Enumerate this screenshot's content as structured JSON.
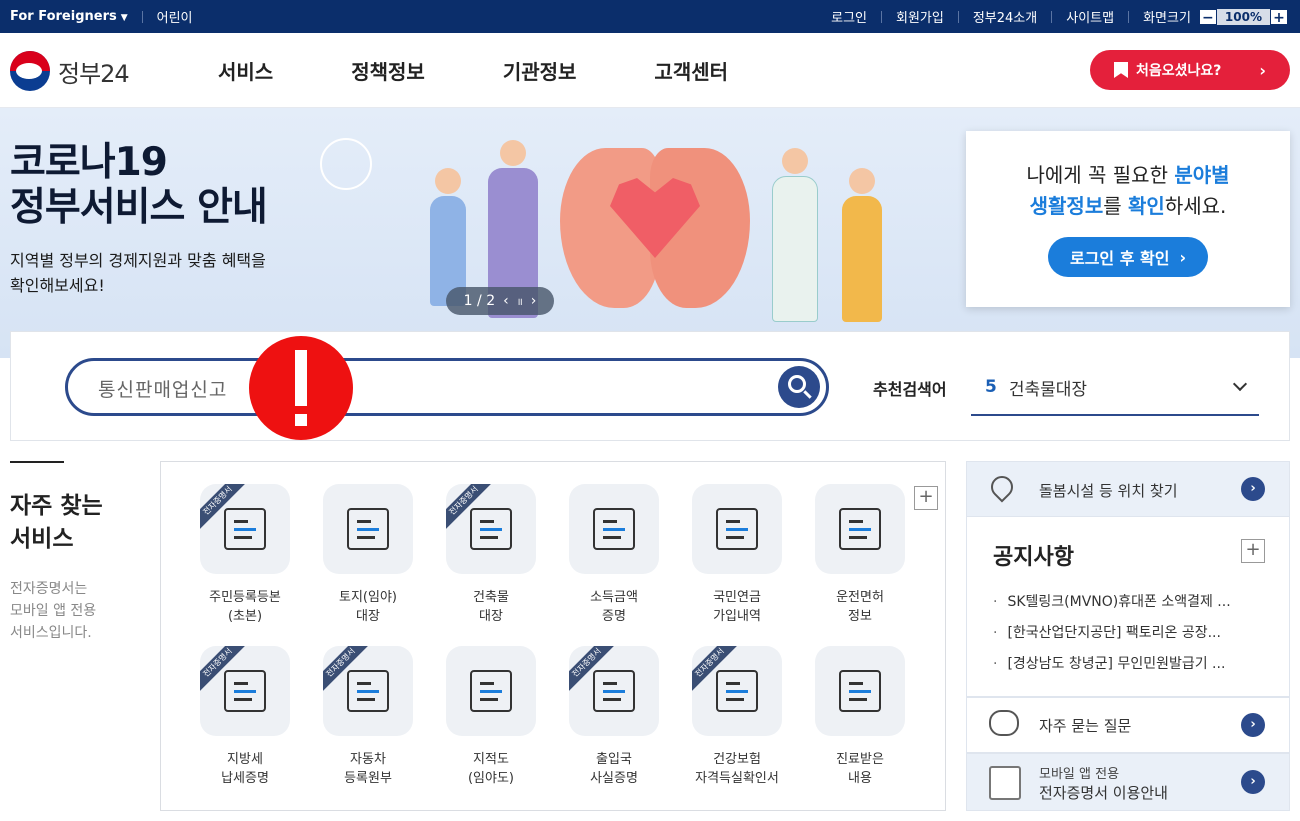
{
  "topbar": {
    "for_foreigners": "For Foreigners",
    "kids": "어린이",
    "links": [
      "로그인",
      "회원가입",
      "정부24소개",
      "사이트맵"
    ],
    "zoom_label": "화면크기",
    "zoom_minus": "−",
    "zoom_value": "100%",
    "zoom_plus": "+"
  },
  "header": {
    "logo_text": "정부24",
    "nav": [
      "서비스",
      "정책정보",
      "기관정보",
      "고객센터"
    ],
    "first_visit_label": "처음오셨나요?",
    "first_visit_arrow": "›"
  },
  "banner": {
    "title_line1": "코로나19",
    "title_line2": "정부서비스 안내",
    "sub_line1": "지역별 정부의 경제지원과 맞춤 혜택을",
    "sub_line2": "확인해보세요!",
    "pager_text": "1 / 2",
    "pager_prev": "‹",
    "pager_pause": "॥",
    "pager_next": "›",
    "promo_line1_a": "나에게 꼭 필요한 ",
    "promo_line1_b": "분야별",
    "promo_line2_a": "생활정보",
    "promo_line2_b": "를 ",
    "promo_line2_c": "확인",
    "promo_line2_d": "하세요.",
    "promo_button": "로그인 후 확인",
    "promo_button_arrow": "›"
  },
  "search": {
    "value": "통신판매업신고",
    "recommend_label": "추천검색어",
    "recommend_num": "5",
    "recommend_value": "건축물대장"
  },
  "frequent": {
    "title": "자주 찾는\n서비스",
    "desc": "전자증명서는\n모바일 앱 전용\n서비스입니다.",
    "plus": "+",
    "ribbon_text": "전자증명서",
    "services": [
      {
        "label": "주민등록등본\n(초본)",
        "ribbon": true
      },
      {
        "label": "토지(임야)\n대장",
        "ribbon": false
      },
      {
        "label": "건축물\n대장",
        "ribbon": true
      },
      {
        "label": "소득금액\n증명",
        "ribbon": false
      },
      {
        "label": "국민연금\n가입내역",
        "ribbon": false
      },
      {
        "label": "운전면허\n정보",
        "ribbon": false
      },
      {
        "label": "지방세\n납세증명",
        "ribbon": true
      },
      {
        "label": "자동차\n등록원부",
        "ribbon": true
      },
      {
        "label": "지적도\n(임야도)",
        "ribbon": false
      },
      {
        "label": "출입국\n사실증명",
        "ribbon": true
      },
      {
        "label": "건강보험\n자격득실확인서",
        "ribbon": true
      },
      {
        "label": "진료받은\n내용",
        "ribbon": false
      }
    ]
  },
  "side": {
    "location_text": "돌봄시설 등 위치 찾기",
    "arrow": "›",
    "notice_title": "공지사항",
    "notice_plus": "+",
    "notices": [
      "SK텔링크(MVNO)휴대폰 소액결제 ...",
      "[한국산업단지공단] 팩토리온 공장...",
      "[경상남도 창녕군] 무인민원발급기 ..."
    ],
    "faq_text": "자주 묻는 질문",
    "mobile_line1": "모바일 앱 전용",
    "mobile_line2": "전자증명서 이용안내"
  },
  "colors": {
    "top_bar": "#0b2e6b",
    "accent_blue": "#1b7ddb",
    "search_border": "#2c4a8c",
    "first_visit_red": "#e4203b",
    "alert_red": "#ee1111"
  }
}
